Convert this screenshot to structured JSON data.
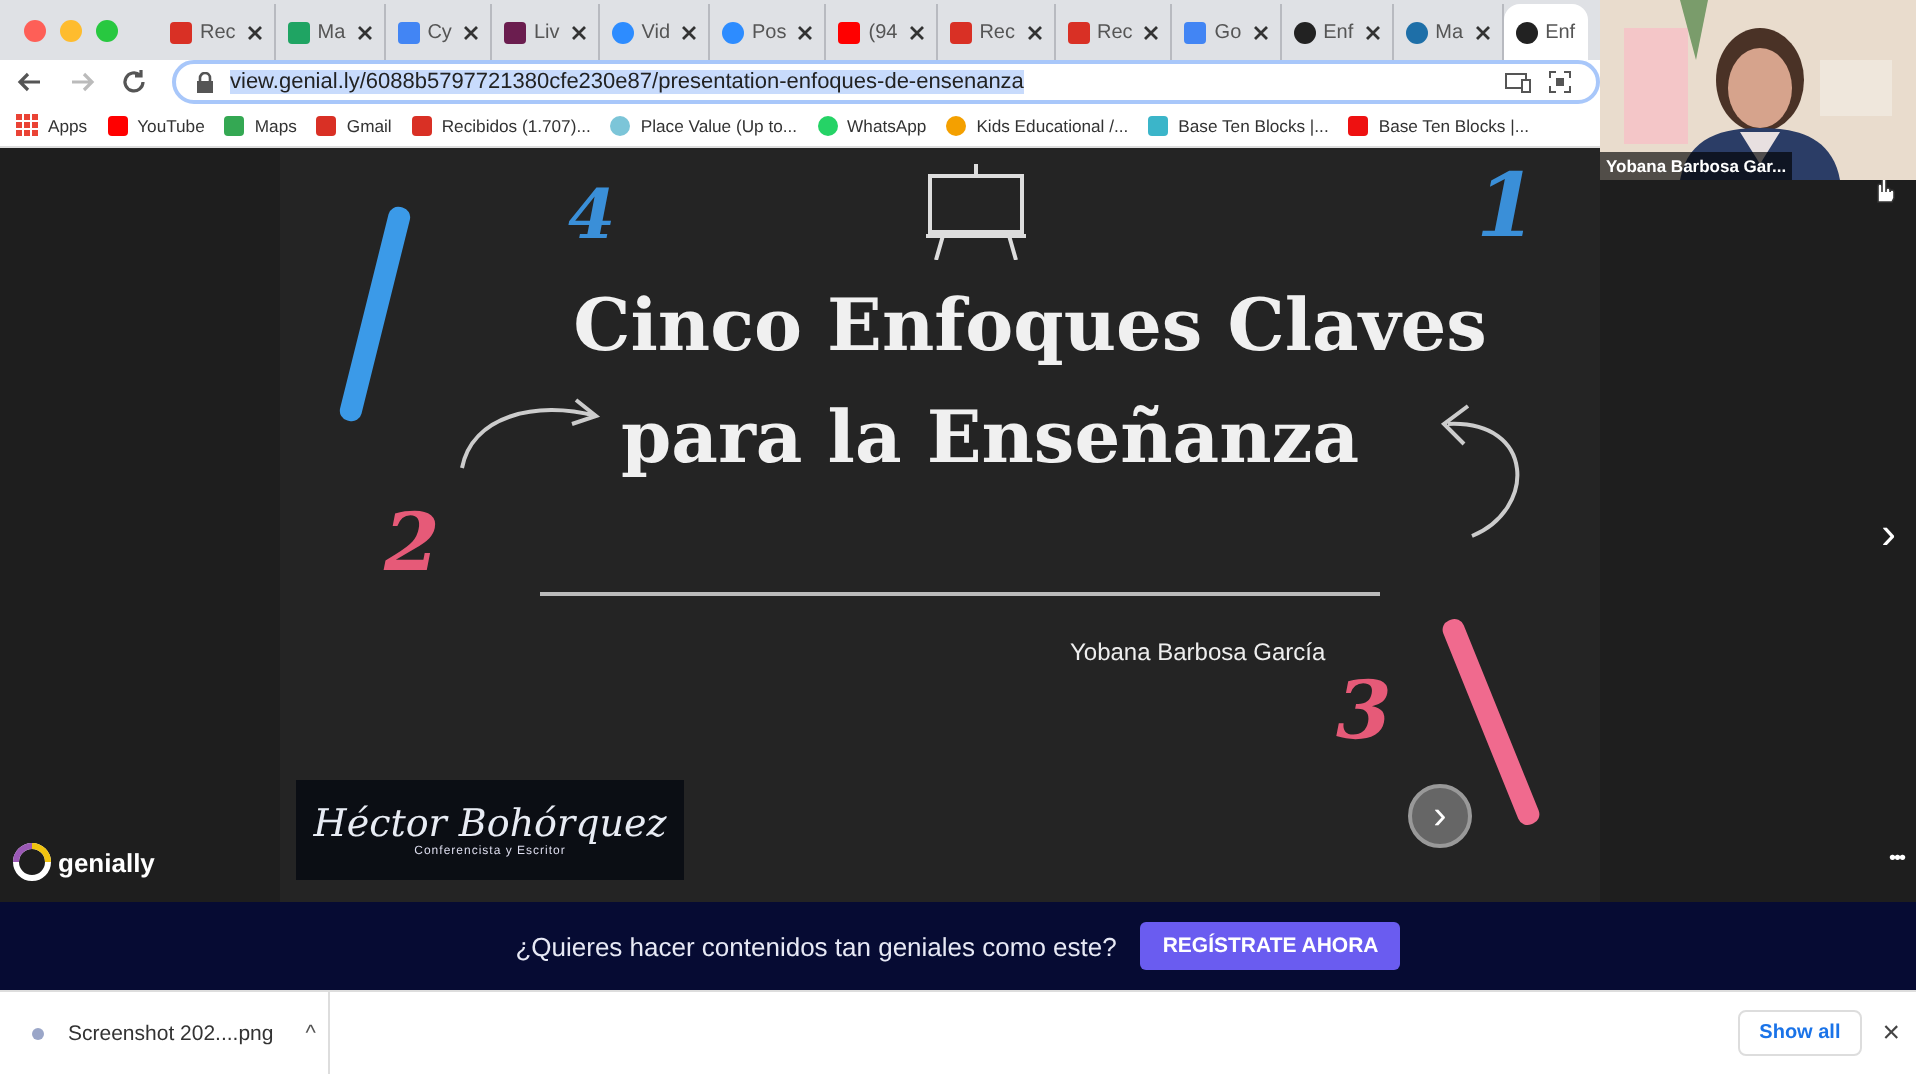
{
  "tabs": [
    {
      "kind": "gmail",
      "label": "Rec",
      "selected": false
    },
    {
      "kind": "drive",
      "label": "Ma",
      "selected": false
    },
    {
      "kind": "docs",
      "label": "Cy",
      "selected": false
    },
    {
      "kind": "app",
      "label": "Liv",
      "selected": false
    },
    {
      "kind": "zoom",
      "label": "Vid",
      "selected": false
    },
    {
      "kind": "zoom",
      "label": "Pos",
      "selected": false
    },
    {
      "kind": "youtube",
      "label": "(94",
      "selected": false
    },
    {
      "kind": "gmail",
      "label": "Rec",
      "selected": false
    },
    {
      "kind": "gmail",
      "label": "Rec",
      "selected": false
    },
    {
      "kind": "calendar",
      "label": "Go",
      "selected": false
    },
    {
      "kind": "genially",
      "label": "Enf",
      "selected": false
    },
    {
      "kind": "globe",
      "label": "Ma",
      "selected": false
    },
    {
      "kind": "genially",
      "label": "Enf",
      "selected": true
    }
  ],
  "address": {
    "url": "view.genial.ly/6088b5797721380cfe230e87/presentation-enfoques-de-ensenanza"
  },
  "bookmarks": [
    {
      "kind": "apps",
      "label": "Apps"
    },
    {
      "kind": "youtube",
      "label": "YouTube"
    },
    {
      "kind": "maps",
      "label": "Maps"
    },
    {
      "kind": "gmail",
      "label": "Gmail"
    },
    {
      "kind": "gmail",
      "label": "Recibidos (1.707)..."
    },
    {
      "kind": "bulb",
      "label": "Place Value (Up to..."
    },
    {
      "kind": "whatsapp",
      "label": "WhatsApp"
    },
    {
      "kind": "ball",
      "label": "Kids Educational /..."
    },
    {
      "kind": "blocks",
      "label": "Base Ten Blocks |..."
    },
    {
      "kind": "square",
      "label": "Base Ten Blocks |..."
    }
  ],
  "video": {
    "kind": "picture",
    "name": "Yobana Barbosa Gar..."
  },
  "slide": {
    "numbers": [
      "4",
      "1",
      "2",
      "3"
    ],
    "title_lines": [
      "Cinco Enfoques Claves",
      "para la Enseñanza"
    ],
    "author": "Yobana Barbosa García",
    "logo_name": "Héctor Bohórquez",
    "logo_subtitle": "Conferencista y Escritor",
    "next": "›",
    "brand": "genially",
    "side_next": "›",
    "more": "•••"
  },
  "banner": {
    "text": "¿Quieres hacer contenidos tan geniales como este?",
    "button": "REGÍSTRATE AHORA"
  },
  "downloads": {
    "file": "Screenshot 202....png",
    "caret": "^",
    "show_all": "Show all",
    "close": "×"
  }
}
